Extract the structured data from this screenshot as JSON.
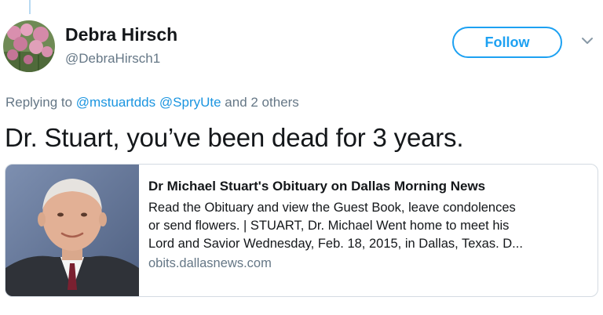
{
  "tweet": {
    "author": {
      "display_name": "Debra Hirsch",
      "handle": "@DebraHirsch1",
      "avatar_icon": "pink-flowers-avatar"
    },
    "follow_label": "Follow",
    "menu_icon": "chevron-down-icon",
    "replying": {
      "prefix": "Replying to",
      "mention_1": "@mstuartdds",
      "mention_2": "@SpryUte",
      "suffix": "and 2 others"
    },
    "text": "Dr. Stuart, you’ve been dead for 3 years.",
    "card": {
      "image_icon": "man-portrait-photo",
      "title": "Dr Michael Stuart's Obituary on Dallas Morning News",
      "description_lines": [
        "Read the Obituary and view the Guest Book, leave condolences",
        "or send flowers. | STUART, Dr. Michael Went home to meet his",
        "Lord and Savior Wednesday, Feb. 18, 2015, in Dallas, Texas. D..."
      ],
      "domain": "obits.dallasnews.com"
    }
  },
  "colors": {
    "accent": "#1da1f2",
    "mention": "#1b95e0",
    "secondary_text": "#657786",
    "primary_text": "#14171a",
    "card_border": "#d4dbe2"
  }
}
